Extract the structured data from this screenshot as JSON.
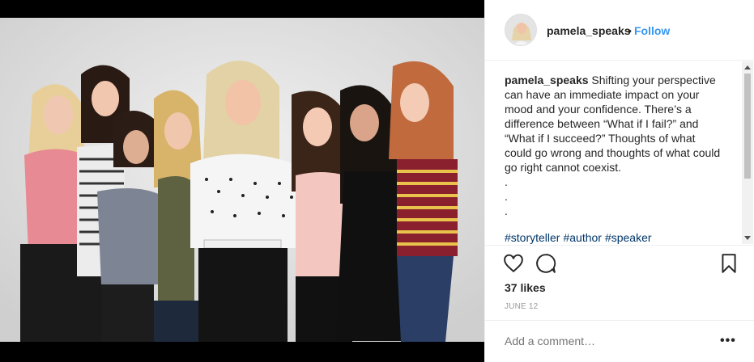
{
  "header": {
    "username": "pamela_speaks",
    "separator": "•",
    "follow_label": "Follow"
  },
  "caption": {
    "username": "pamela_speaks",
    "text": "Shifting your perspective can have an immediate impact on your mood and your confidence. There’s a difference between “What if I fail?” and “What if I succeed?” Thoughts of what could go wrong and thoughts of what could go right cannot coexist.",
    "dots": [
      ".",
      ".",
      "."
    ],
    "hashtags": [
      "#storyteller",
      "#author",
      "#speaker"
    ]
  },
  "actions": {
    "like_icon": "heart-icon",
    "comment_icon": "comment-icon",
    "save_icon": "bookmark-icon"
  },
  "likes": "37 likes",
  "date": "JUNE 12",
  "comment": {
    "placeholder": "Add a comment…",
    "more_label": "•••"
  },
  "colors": {
    "follow": "#3897f0",
    "hashtag": "#003569",
    "muted": "#999999",
    "text": "#262626"
  }
}
